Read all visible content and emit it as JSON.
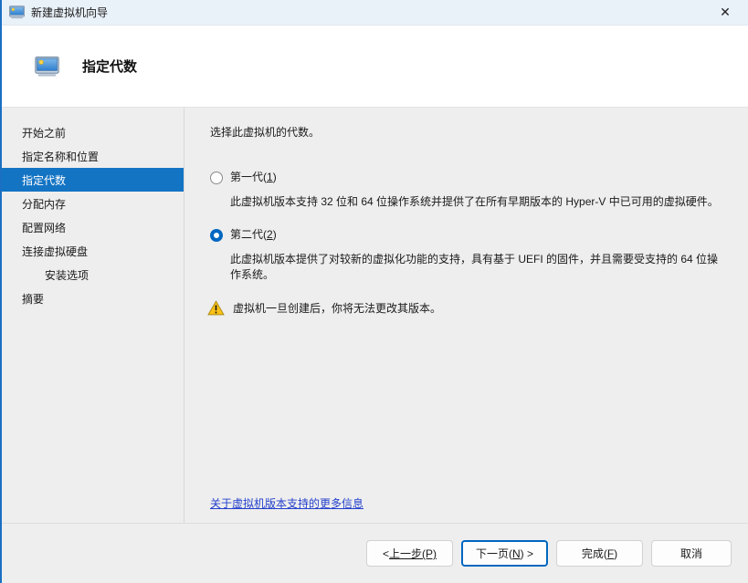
{
  "window": {
    "title": "新建虚拟机向导",
    "close_glyph": "✕"
  },
  "header": {
    "title": "指定代数"
  },
  "sidebar": {
    "items": [
      {
        "label": "开始之前",
        "selected": false,
        "indent": false
      },
      {
        "label": "指定名称和位置",
        "selected": false,
        "indent": false
      },
      {
        "label": "指定代数",
        "selected": true,
        "indent": false
      },
      {
        "label": "分配内存",
        "selected": false,
        "indent": false
      },
      {
        "label": "配置网络",
        "selected": false,
        "indent": false
      },
      {
        "label": "连接虚拟硬盘",
        "selected": false,
        "indent": false
      },
      {
        "label": "安装选项",
        "selected": false,
        "indent": true
      },
      {
        "label": "摘要",
        "selected": false,
        "indent": false
      }
    ]
  },
  "main": {
    "prompt": "选择此虚拟机的代数。",
    "options": [
      {
        "pre": "第一代(",
        "key": "1",
        "post": ")",
        "checked": false,
        "description": "此虚拟机版本支持 32 位和 64 位操作系统并提供了在所有早期版本的 Hyper-V 中已可用的虚拟硬件。"
      },
      {
        "pre": "第二代(",
        "key": "2",
        "post": ")",
        "checked": true,
        "description": "此虚拟机版本提供了对较新的虚拟化功能的支持，具有基于 UEFI 的固件，并且需要受支持的 64 位操作系统。"
      }
    ],
    "warning": "虚拟机一旦创建后，你将无法更改其版本。",
    "link": "关于虚拟机版本支持的更多信息"
  },
  "footer": {
    "back": {
      "prefix": "< ",
      "label": "上一步(P)"
    },
    "next": {
      "pre": "下一页(",
      "key": "N",
      "post": ") >"
    },
    "finish": {
      "pre": "完成(",
      "key": "F",
      "post": ")"
    },
    "cancel": "取消"
  },
  "colors": {
    "accent": "#0067c0",
    "sidebar_selected": "#1474c4",
    "window_border": "#1b6fc2",
    "titlebar_bg": "#e9f1f9",
    "link": "#2440cc",
    "warning_yellow": "#fdc116"
  }
}
